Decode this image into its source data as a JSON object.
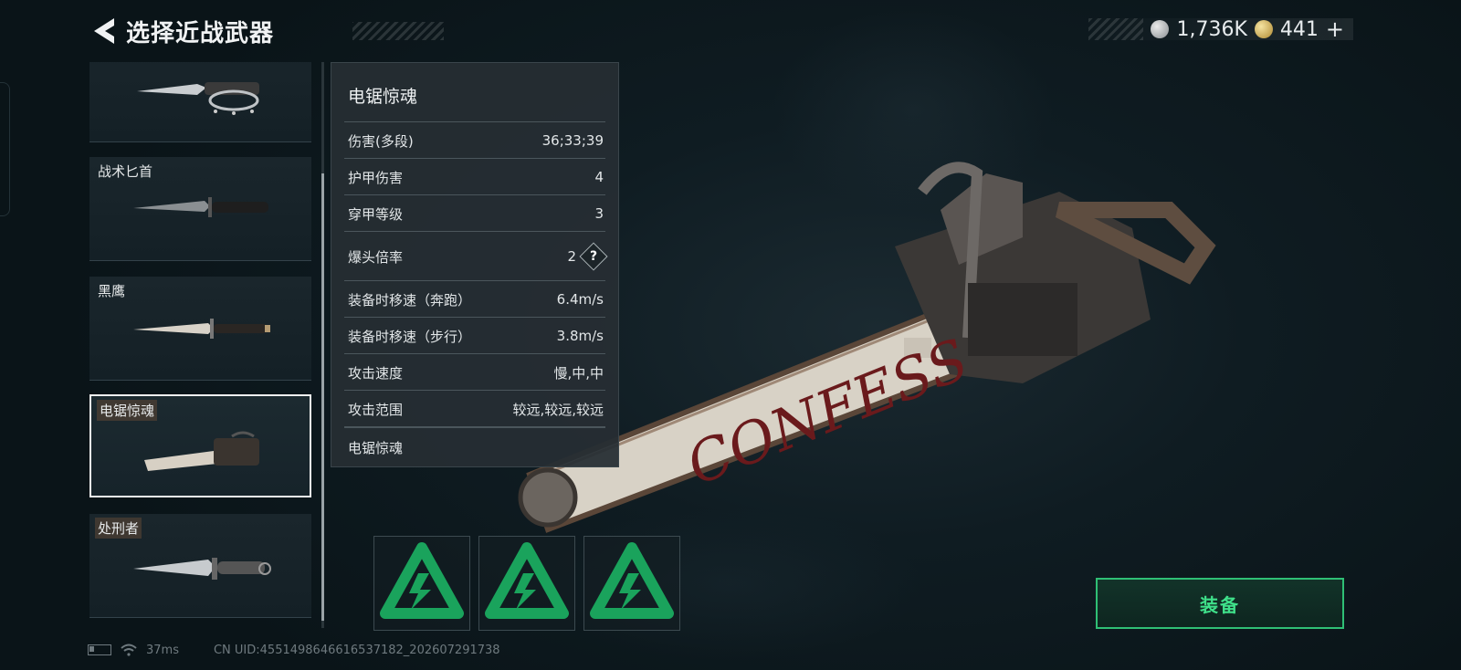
{
  "header": {
    "title": "选择近战武器"
  },
  "currency": {
    "silver": "1,736K",
    "gold": "441",
    "plus": "+"
  },
  "weapon_list": [
    {
      "label": "",
      "selected": false
    },
    {
      "label": "战术匕首",
      "selected": false
    },
    {
      "label": "黑鹰",
      "selected": false
    },
    {
      "label": "电锯惊魂",
      "selected": true
    },
    {
      "label": "处刑者",
      "selected": false
    }
  ],
  "stats": {
    "name": "电锯惊魂",
    "rows": [
      {
        "key": "伤害(多段)",
        "value": "36;33;39"
      },
      {
        "key": "护甲伤害",
        "value": "4"
      },
      {
        "key": "穿甲等级",
        "value": "3"
      },
      {
        "key": "爆头倍率",
        "value": "2",
        "help": "?"
      },
      {
        "key": "装备时移速（奔跑）",
        "value": "6.4m/s"
      },
      {
        "key": "装备时移速（步行）",
        "value": "3.8m/s"
      },
      {
        "key": "攻击速度",
        "value": "慢,中,中"
      },
      {
        "key": "攻击范围",
        "value": "较远,较远,较远"
      }
    ],
    "footer_name": "电锯惊魂"
  },
  "weapon_graffiti": "CONFESS",
  "equip_button": "装备",
  "footer": {
    "ping": "37ms",
    "uid": "CN UID:4551498646616537182_202607291738"
  },
  "colors": {
    "accent_green": "#2fbf75",
    "panel": "#262e33"
  }
}
